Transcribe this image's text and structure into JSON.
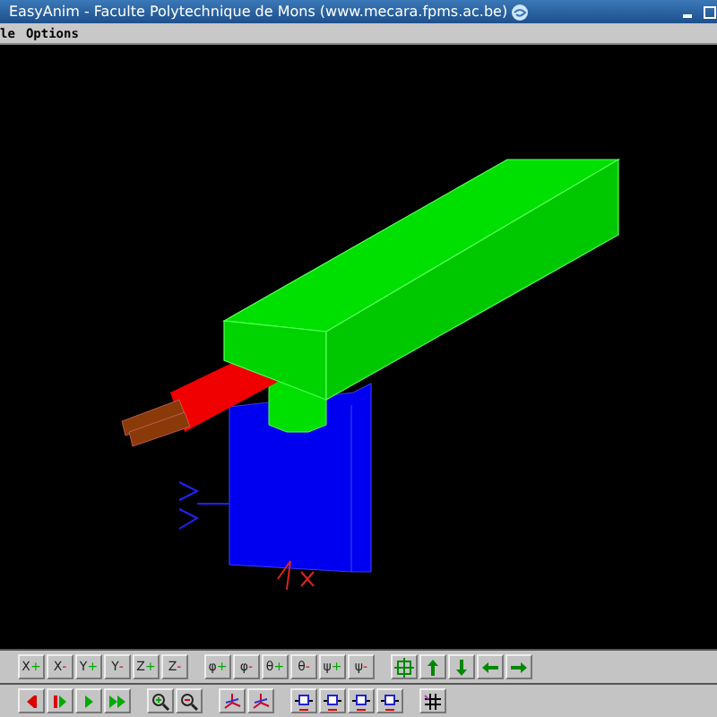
{
  "window": {
    "title": "EasyAnim - Faculte Polytechnique de Mons (www.mecara.fpms.ac.be)"
  },
  "menu": [
    "le",
    "Options"
  ],
  "viewport": {
    "kind": "scene"
  },
  "toolbars": [
    {
      "groups": [
        [
          {
            "kind": "text",
            "label": "X",
            "sign": "+"
          },
          {
            "kind": "text",
            "label": "X",
            "sign": "-"
          },
          {
            "kind": "text",
            "label": "Y",
            "sign": "+"
          },
          {
            "kind": "text",
            "label": "Y",
            "sign": "-"
          },
          {
            "kind": "text",
            "label": "Z",
            "sign": "+"
          },
          {
            "kind": "text",
            "label": "Z",
            "sign": "-"
          }
        ],
        [
          {
            "kind": "text",
            "label": "φ",
            "sign": "+"
          },
          {
            "kind": "text",
            "label": "φ",
            "sign": "-"
          },
          {
            "kind": "text",
            "label": "θ",
            "sign": "+"
          },
          {
            "kind": "text",
            "label": "θ",
            "sign": "-"
          },
          {
            "kind": "text",
            "label": "ψ",
            "sign": "+"
          },
          {
            "kind": "text",
            "label": "ψ",
            "sign": "-"
          }
        ],
        [
          {
            "kind": "center"
          },
          {
            "kind": "up"
          },
          {
            "kind": "down"
          },
          {
            "kind": "left"
          },
          {
            "kind": "right"
          }
        ]
      ]
    },
    {
      "groups": [
        [
          {
            "kind": "back"
          },
          {
            "kind": "pause"
          },
          {
            "kind": "play"
          },
          {
            "kind": "fast"
          }
        ],
        [
          {
            "kind": "zoomin"
          },
          {
            "kind": "zoomout"
          }
        ],
        [
          {
            "kind": "axes"
          },
          {
            "kind": "axes"
          }
        ],
        [
          {
            "kind": "dim"
          },
          {
            "kind": "dim"
          },
          {
            "kind": "dim"
          },
          {
            "kind": "dim"
          }
        ],
        [
          {
            "kind": "grid"
          }
        ]
      ]
    }
  ]
}
